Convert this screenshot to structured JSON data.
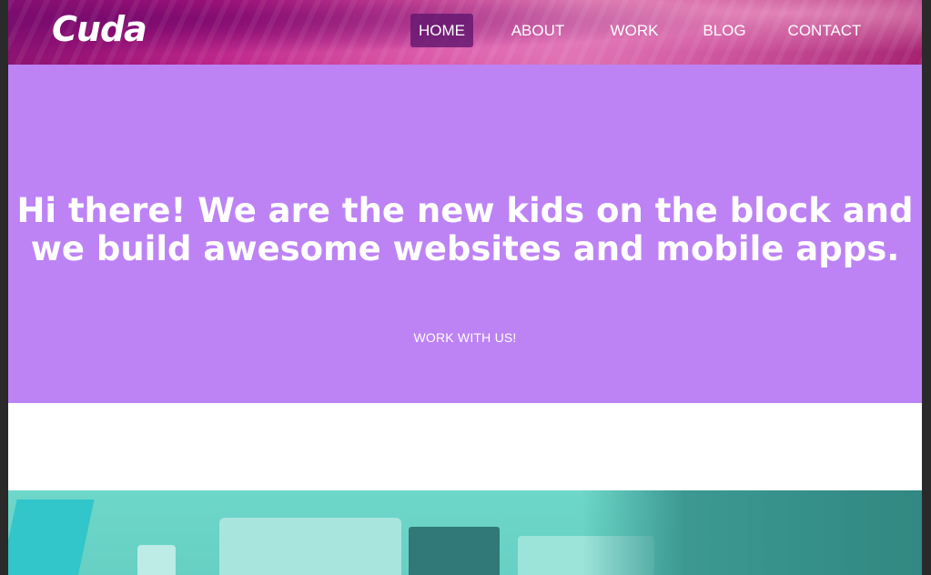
{
  "header": {
    "logo_text": "Cuda",
    "nav": [
      {
        "label": "HOME",
        "active": true
      },
      {
        "label": "ABOUT",
        "active": false
      },
      {
        "label": "WORK",
        "active": false
      },
      {
        "label": "BLOG",
        "active": false
      },
      {
        "label": "CONTACT",
        "active": false
      }
    ]
  },
  "hero": {
    "title": "Hi there! We are the new kids on the block and we build awesome websites and mobile apps.",
    "cta_label": "WORK WITH US!",
    "background_color": "#bd83f5"
  },
  "colors": {
    "accent_purple": "#bd83f5",
    "nav_active_bg": "#5f146e",
    "photo_tint": "#7fdcd0"
  }
}
